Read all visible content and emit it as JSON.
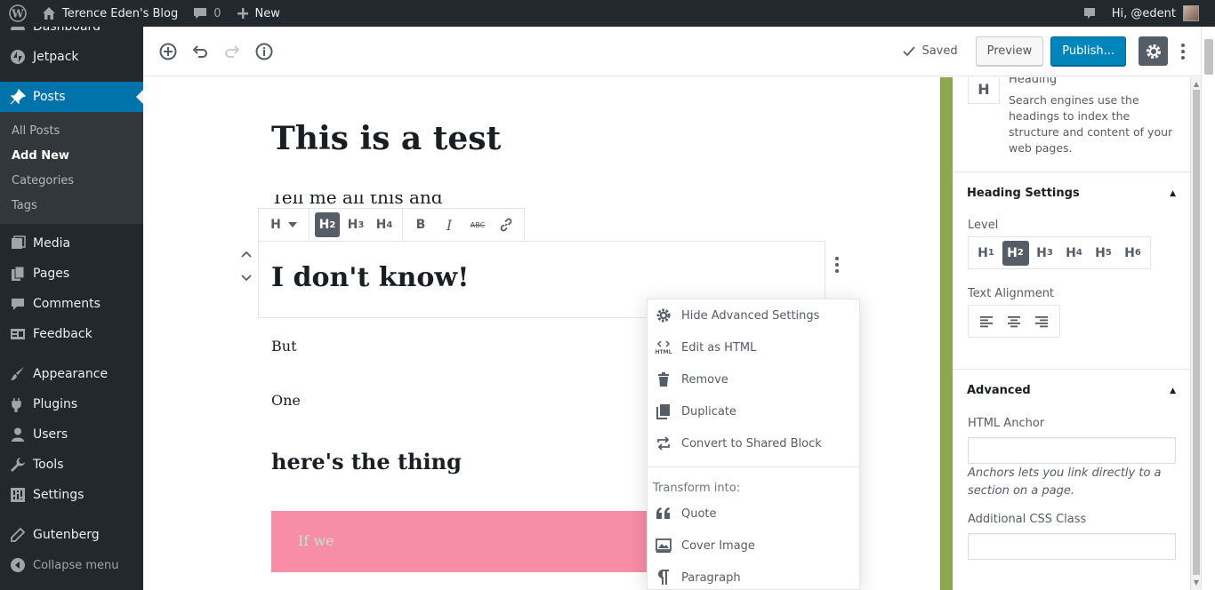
{
  "admin_bar": {
    "site_name": "Terence Eden's Blog",
    "comments_count": "0",
    "new_label": "New",
    "greeting": "Hi, @edent"
  },
  "sidebar": {
    "items_top": [
      {
        "label": "Dashboard",
        "icon": "dashboard-icon"
      },
      {
        "label": "Jetpack",
        "icon": "jetpack-icon"
      },
      {
        "label": "Posts",
        "icon": "pin-icon"
      }
    ],
    "submenu": [
      "All Posts",
      "Add New",
      "Categories",
      "Tags"
    ],
    "items_bottom": [
      {
        "label": "Media",
        "icon": "media-icon"
      },
      {
        "label": "Pages",
        "icon": "pages-icon"
      },
      {
        "label": "Comments",
        "icon": "comments-icon"
      },
      {
        "label": "Feedback",
        "icon": "feedback-icon"
      },
      {
        "label": "Appearance",
        "icon": "brush-icon"
      },
      {
        "label": "Plugins",
        "icon": "plugin-icon"
      },
      {
        "label": "Users",
        "icon": "users-icon"
      },
      {
        "label": "Tools",
        "icon": "wrench-icon"
      },
      {
        "label": "Settings",
        "icon": "settings-icon"
      },
      {
        "label": "Gutenberg",
        "icon": "pencil-icon"
      }
    ],
    "collapse_label": "Collapse menu"
  },
  "toolbar": {
    "saved_label": "Saved",
    "preview_label": "Preview",
    "publish_label": "Publish..."
  },
  "editor": {
    "title": "This is a test",
    "ghost_text": "Tell me all this and",
    "heading_block": "I don't know!",
    "para1": "But",
    "para2": "One",
    "heading2": "here's the thing",
    "pink_text": "If we"
  },
  "block_toolbar": {
    "heading_switcher": "H",
    "levels": [
      {
        "h": "H",
        "n": "2"
      },
      {
        "h": "H",
        "n": "3"
      },
      {
        "h": "H",
        "n": "4"
      }
    ],
    "bold": "B",
    "italic": "I",
    "strike": "ABC"
  },
  "block_menu": {
    "items": [
      "Hide Advanced Settings",
      "Edit as HTML",
      "Remove",
      "Duplicate",
      "Convert to Shared Block"
    ],
    "html_icon_text": "HTML",
    "transform_label": "Transform into:",
    "transforms": [
      "Quote",
      "Cover Image",
      "Paragraph"
    ]
  },
  "settings_panel": {
    "block_icon": "H",
    "block_name": "Heading",
    "block_desc": "Search engines use the headings to index the structure and content of your web pages.",
    "heading_settings_title": "Heading Settings",
    "level_label": "Level",
    "levels": [
      "1",
      "2",
      "3",
      "4",
      "5",
      "6"
    ],
    "level_prefix": "H",
    "alignment_label": "Text Alignment",
    "advanced_title": "Advanced",
    "anchor_label": "HTML Anchor",
    "anchor_help": "Anchors lets you link directly to a section on a page.",
    "css_label": "Additional CSS Class"
  },
  "colors": {
    "admin_bar": "#23282d",
    "active_menu": "#0073aa",
    "publish": "#0085ba",
    "pink_block": "#f78da7",
    "green_bar": "#8ea94d"
  }
}
